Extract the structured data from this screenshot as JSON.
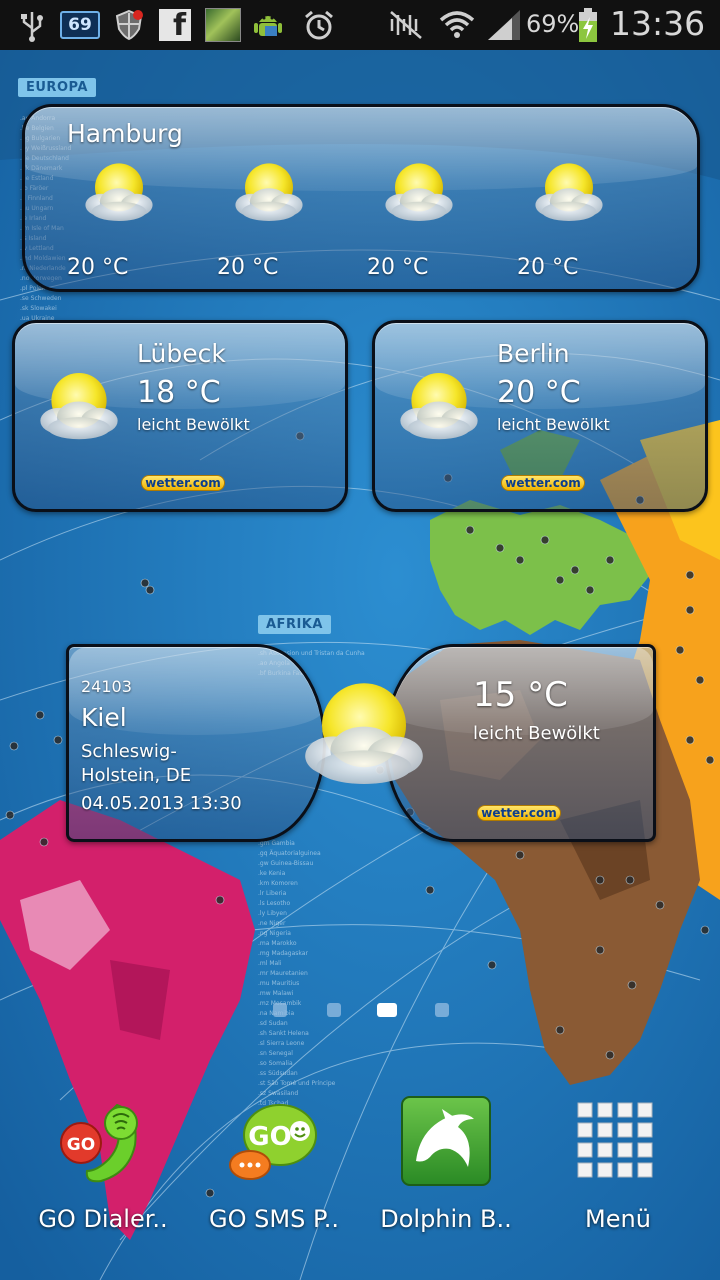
{
  "status_bar": {
    "notification_badge": "69",
    "battery_percent": "69%",
    "time": "13:36",
    "icons": [
      "usb-icon",
      "badge-69-icon",
      "shield-icon",
      "facebook-icon",
      "game-icon",
      "android-icon",
      "alarm-icon",
      "mute-icon",
      "wifi-icon",
      "signal-icon",
      "battery-charging-icon"
    ]
  },
  "wallpaper": {
    "region_europe": "EUROPA",
    "region_africa": "AFRIKA"
  },
  "widgets": {
    "hamburg": {
      "city": "Hamburg",
      "temps": [
        "20 °C",
        "20 °C",
        "20 °C",
        "20 °C"
      ]
    },
    "luebeck": {
      "city": "Lübeck",
      "temp": "18 °C",
      "condition": "leicht Bewölkt",
      "brand": "wetter.com"
    },
    "berlin": {
      "city": "Berlin",
      "temp": "20 °C",
      "condition": "leicht Bewölkt",
      "brand": "wetter.com"
    },
    "kiel": {
      "zip": "24103",
      "city": "Kiel",
      "region_line1": "Schleswig-",
      "region_line2": "Holstein, DE",
      "datetime": "04.05.2013 13:30",
      "temp": "15 °C",
      "condition": "leicht Bewölkt",
      "brand": "wetter.com"
    }
  },
  "page_indicator": {
    "pages": 4,
    "active_index": 2
  },
  "dock": [
    {
      "label": "GO Dialer..",
      "icon": "go-dialer-icon"
    },
    {
      "label": "GO SMS P..",
      "icon": "go-sms-icon"
    },
    {
      "label": "Dolphin B..",
      "icon": "dolphin-browser-icon"
    },
    {
      "label": "Menü",
      "icon": "app-drawer-icon"
    }
  ],
  "colors": {
    "wallpaper_blue": "#1a6fb5",
    "europe_green": "#7cc04a",
    "africa_brown": "#8a5a34",
    "americas_magenta": "#d3206b",
    "asia_orange": "#f7a21c",
    "brand_yellow": "#f0b400"
  }
}
